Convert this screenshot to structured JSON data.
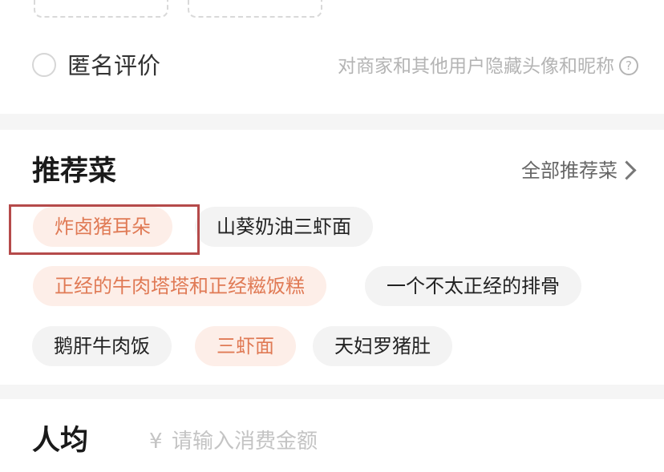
{
  "anonymous": {
    "label": "匿名评价",
    "hint": "对商家和其他用户隐藏头像和昵称",
    "help_glyph": "?"
  },
  "recommended": {
    "title": "推荐菜",
    "all_link": "全部推荐菜",
    "dishes": [
      {
        "label": "炸卤猪耳朵",
        "selected": true
      },
      {
        "label": "山葵奶油三虾面",
        "selected": false
      },
      {
        "label": "正经的牛肉塔塔和正经糍饭糕",
        "selected": true
      },
      {
        "label": "一个不太正经的排骨",
        "selected": false
      },
      {
        "label": "鹅肝牛肉饭",
        "selected": false
      },
      {
        "label": "三虾面",
        "selected": true
      },
      {
        "label": "天妇罗猪肚",
        "selected": false
      }
    ]
  },
  "average": {
    "label": "人均",
    "currency": "¥",
    "placeholder": "请输入消费金额",
    "value": ""
  },
  "colors": {
    "accent": "#e07a55",
    "selected_bg": "#fdeee8",
    "chip_bg": "#f3f3f3",
    "highlight": "#b54a4a"
  },
  "icons": [
    "radio-unchecked",
    "help-circle-icon",
    "chevron-right-icon"
  ]
}
